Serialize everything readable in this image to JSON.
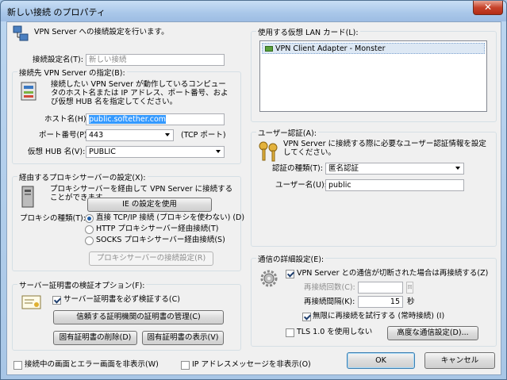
{
  "window": {
    "title": "新しい接続 のプロパティ",
    "close": "✕"
  },
  "header": {
    "text": "VPN Server への接続設定を行います。"
  },
  "setting_name": {
    "label": "接続設定名(T):",
    "value": "新しい接続"
  },
  "destination": {
    "group": "接続先 VPN Server の指定(B):",
    "description": "接続したい VPN Server が動作しているコンピュータのホスト名または IP アドレス、ポート番号、および仮想 HUB 名を指定してください。",
    "host_label": "ホスト名(H):",
    "host_value": "public.softether.com",
    "port_label": "ポート番号(P):",
    "port_value": "443",
    "port_suffix": "(TCP ポート)",
    "hub_label": "仮想 HUB 名(V):",
    "hub_value": "PUBLIC"
  },
  "proxy": {
    "group": "経由するプロキシサーバーの設定(X):",
    "description": "プロキシサーバーを経由して VPN Server に接続することができます。",
    "ie_button": "IE の設定を使用",
    "type_label": "プロキシの種類(T):",
    "options": [
      "直接 TCP/IP 接続 (プロキシを使わない) (D)",
      "HTTP プロキシサーバー経由接続(T)",
      "SOCKS プロキシサーバー経由接続(S)"
    ],
    "selected_index": 0,
    "settings_button": "プロキシサーバーの接続設定(R)"
  },
  "cert": {
    "group": "サーバー証明書の検証オプション(F):",
    "verify_label": "サーバー証明書を必ず検証する(C)",
    "manage_button": "信頼する証明機関の証明書の管理(C)",
    "delete_button": "固有証明書の削除(D)",
    "show_button": "固有証明書の表示(V)"
  },
  "lan_card": {
    "group": "使用する仮想 LAN カード(L):",
    "item": "VPN Client Adapter - Monster"
  },
  "auth": {
    "group": "ユーザー認証(A):",
    "description": "VPN Server に接続する際に必要なユーザー認証情報を設定してください。",
    "type_label": "認証の種類(T):",
    "type_value": "匿名認証",
    "user_label": "ユーザー名(U):",
    "user_value": "public"
  },
  "comm": {
    "group": "通信の詳細設定(E):",
    "reconnect_label": "VPN Server との通信が切断された場合は再接続する(Z)",
    "retry_count_label": "再接続回数(C):",
    "retry_count_unit": "回",
    "interval_label": "再接続間隔(K):",
    "interval_value": "15",
    "interval_unit": "秒",
    "infinite_label": "無限に再接続を試行する (常時接続) (I)",
    "no_tls_label": "TLS 1.0 を使用しない",
    "advanced_button": "高度な通信設定(D)..."
  },
  "footer": {
    "hide_screens_label": "接続中の画面とエラー画面を非表示(W)",
    "hide_ip_label": "IP アドレスメッセージを非表示(O)",
    "ok_button": "OK",
    "cancel_button": "キャンセル"
  }
}
